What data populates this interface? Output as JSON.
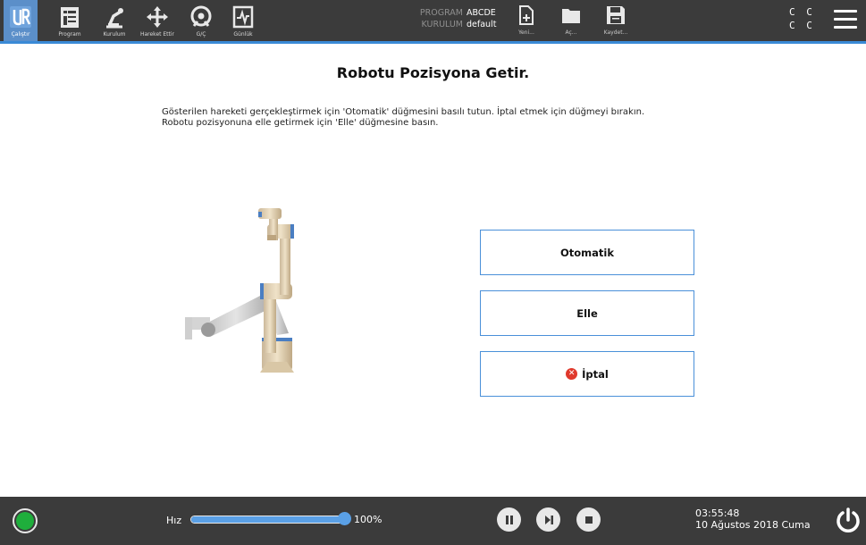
{
  "topbar": {
    "nav": [
      {
        "label": "Çalıştır",
        "icon": "ur-logo-icon",
        "active": true
      },
      {
        "label": "Program",
        "icon": "program-icon"
      },
      {
        "label": "Kurulum",
        "icon": "installation-icon"
      },
      {
        "label": "Hareket Ettir",
        "icon": "move-icon"
      },
      {
        "label": "G/Ç",
        "icon": "io-icon"
      },
      {
        "label": "Günlük",
        "icon": "log-icon"
      }
    ],
    "program_key": "PROGRAM",
    "program_value": "ABCDE",
    "installation_key": "KURULUM",
    "installation_value": "default",
    "file": [
      {
        "label": "Yeni...",
        "icon": "new-file-icon"
      },
      {
        "label": "Aç...",
        "icon": "folder-icon"
      },
      {
        "label": "Kaydet...",
        "icon": "save-icon"
      }
    ],
    "cc_row1": "C C",
    "cc_row2": "C C",
    "accent": "#3a8ad6"
  },
  "main": {
    "title": "Robotu Pozisyona Getir.",
    "instruction_1": "Gösterilen hareketi gerçekleştirmek için 'Otomatik' düğmesini basılı tutun. İptal etmek için düğmeyi bırakın.",
    "instruction_2": "Robotu pozisyonuna elle getirmek için 'Elle' düğmesine basın.",
    "buttons": {
      "auto": "Otomatik",
      "manual": "Elle",
      "cancel": "İptal"
    }
  },
  "bottombar": {
    "speed_label": "Hız",
    "speed_value": "100%",
    "speed_fraction": 1.0,
    "time": "03:55:48",
    "date": "10 Ağustos 2018 Cuma",
    "status_color": "#1fae3c"
  }
}
